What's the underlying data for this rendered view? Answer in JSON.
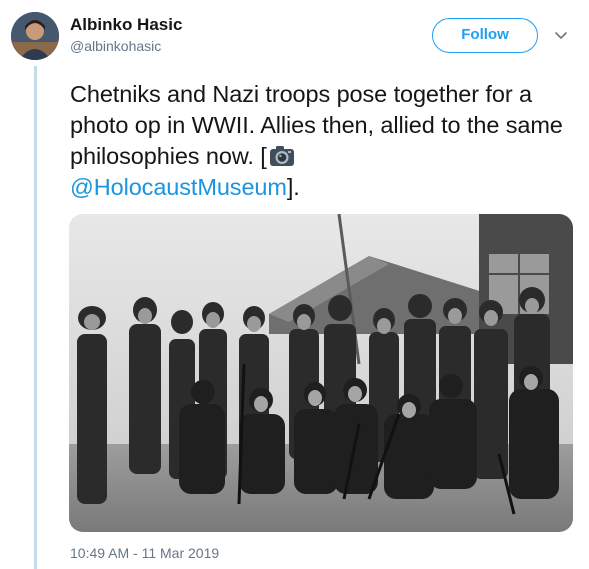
{
  "user": {
    "name": "Albinko Hasic",
    "handle": "@albinkohasic"
  },
  "follow_label": "Follow",
  "tweet": {
    "text_part1": "Chetniks and Nazi troops pose together for a photo op in WWII. Allies then, allied to the same philosophies now.  [",
    "mention": "@HolocaustMuseum",
    "text_part2": "]."
  },
  "timestamp": "10:49 AM - 11 Mar 2019",
  "colors": {
    "accent": "#1da1f2",
    "link": "#1b95e0",
    "muted": "#657786",
    "thread_line": "#c4dbe9"
  },
  "icons": [
    "camera-icon",
    "chevron-down-icon"
  ]
}
